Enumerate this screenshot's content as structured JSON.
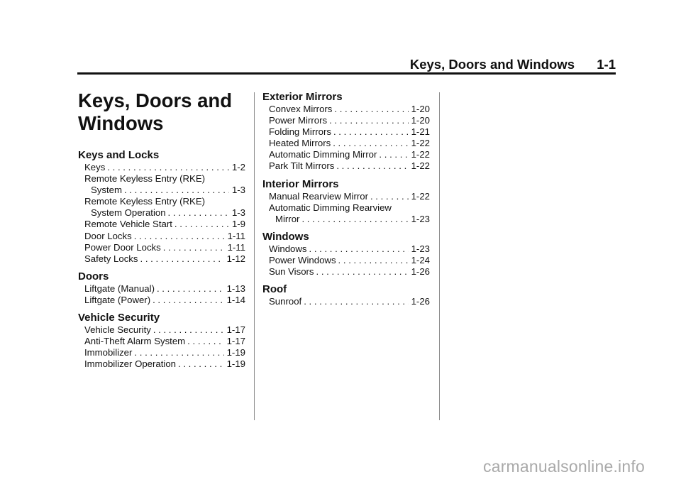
{
  "header": {
    "title": "Keys, Doors and Windows",
    "page_number": "1-1"
  },
  "chapter_title_line1": "Keys, Doors and",
  "chapter_title_line2": "Windows",
  "sections": [
    {
      "title": "Keys and Locks",
      "entries": [
        {
          "label": "Keys",
          "page": "1-2"
        },
        {
          "label": "Remote Keyless Entry (RKE)",
          "cont": "System",
          "page": "1-3"
        },
        {
          "label": "Remote Keyless Entry (RKE)",
          "cont": "System Operation",
          "page": "1-3"
        },
        {
          "label": "Remote Vehicle Start",
          "page": "1-9"
        },
        {
          "label": "Door Locks",
          "page": "1-11"
        },
        {
          "label": "Power Door Locks",
          "page": "1-11"
        },
        {
          "label": "Safety Locks",
          "page": "1-12"
        }
      ]
    },
    {
      "title": "Doors",
      "entries": [
        {
          "label": "Liftgate (Manual)",
          "page": "1-13"
        },
        {
          "label": "Liftgate (Power)",
          "page": "1-14"
        }
      ]
    },
    {
      "title": "Vehicle Security",
      "entries": [
        {
          "label": "Vehicle Security",
          "page": "1-17"
        },
        {
          "label": "Anti-Theft Alarm System",
          "page": "1-17"
        },
        {
          "label": "Immobilizer",
          "page": "1-19"
        },
        {
          "label": "Immobilizer Operation",
          "page": "1-19"
        }
      ]
    },
    {
      "title": "Exterior Mirrors",
      "entries": [
        {
          "label": "Convex Mirrors",
          "page": "1-20"
        },
        {
          "label": "Power Mirrors",
          "page": "1-20"
        },
        {
          "label": "Folding Mirrors",
          "page": "1-21"
        },
        {
          "label": "Heated Mirrors",
          "page": "1-22"
        },
        {
          "label": "Automatic Dimming Mirror",
          "page": "1-22"
        },
        {
          "label": "Park Tilt Mirrors",
          "page": "1-22"
        }
      ]
    },
    {
      "title": "Interior Mirrors",
      "entries": [
        {
          "label": "Manual Rearview Mirror",
          "page": "1-22"
        },
        {
          "label": "Automatic Dimming Rearview",
          "cont": "Mirror",
          "page": "1-23"
        }
      ]
    },
    {
      "title": "Windows",
      "entries": [
        {
          "label": "Windows",
          "page": "1-23"
        },
        {
          "label": "Power Windows",
          "page": "1-24"
        },
        {
          "label": "Sun Visors",
          "page": "1-26"
        }
      ]
    },
    {
      "title": "Roof",
      "entries": [
        {
          "label": "Sunroof",
          "page": "1-26"
        }
      ]
    }
  ],
  "watermark": "carmanualsonline.info"
}
